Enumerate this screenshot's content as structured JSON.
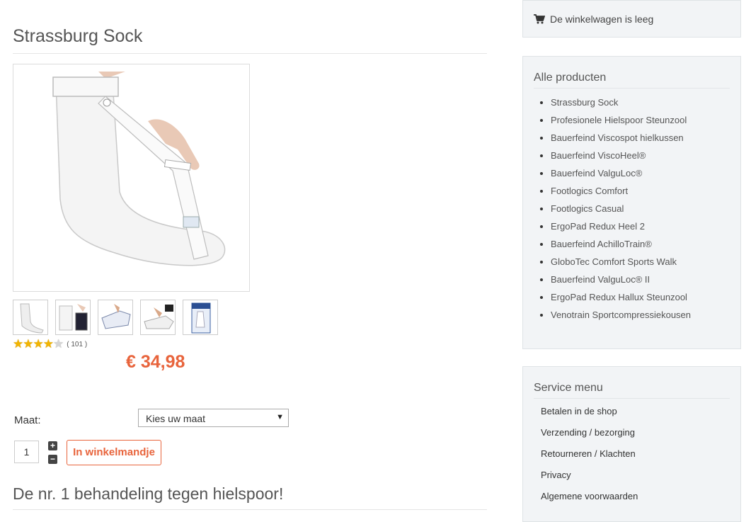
{
  "product": {
    "title": "Strassburg Sock",
    "rating_stars": 4,
    "rating_max": 5,
    "rating_count": "( 101 )",
    "price": "€ 34,98",
    "size_label": "Maat:",
    "size_select_value": "Kies uw maat",
    "quantity": "1",
    "add_to_cart_label": "In winkelmandje",
    "subtitle": "De nr. 1 behandeling tegen hielspoor!"
  },
  "cart": {
    "status": "De winkelwagen is leeg",
    "icon": "shopping-cart-icon"
  },
  "products_panel": {
    "title": "Alle producten",
    "items": [
      "Strassburg Sock",
      "Profesionele Hielspoor Steunzool",
      "Bauerfeind Viscospot hielkussen",
      "Bauerfeind ViscoHeel®",
      "Bauerfeind ValguLoc®",
      "Footlogics Comfort",
      "Footlogics Casual",
      "ErgoPad Redux Heel 2",
      "Bauerfeind AchilloTrain®",
      "GloboTec Comfort Sports Walk",
      "Bauerfeind ValguLoc® II",
      "ErgoPad Redux Hallux Steunzool",
      "Venotrain Sportcompressiekousen"
    ]
  },
  "service_panel": {
    "title": "Service menu",
    "items": [
      "Betalen in de shop",
      "Verzending / bezorging",
      "Retourneren / Klachten",
      "Privacy",
      "Algemene voorwaarden"
    ]
  },
  "colors": {
    "accent": "#e8643c",
    "star": "#f2b400",
    "panel_bg": "#f2f4f6"
  }
}
